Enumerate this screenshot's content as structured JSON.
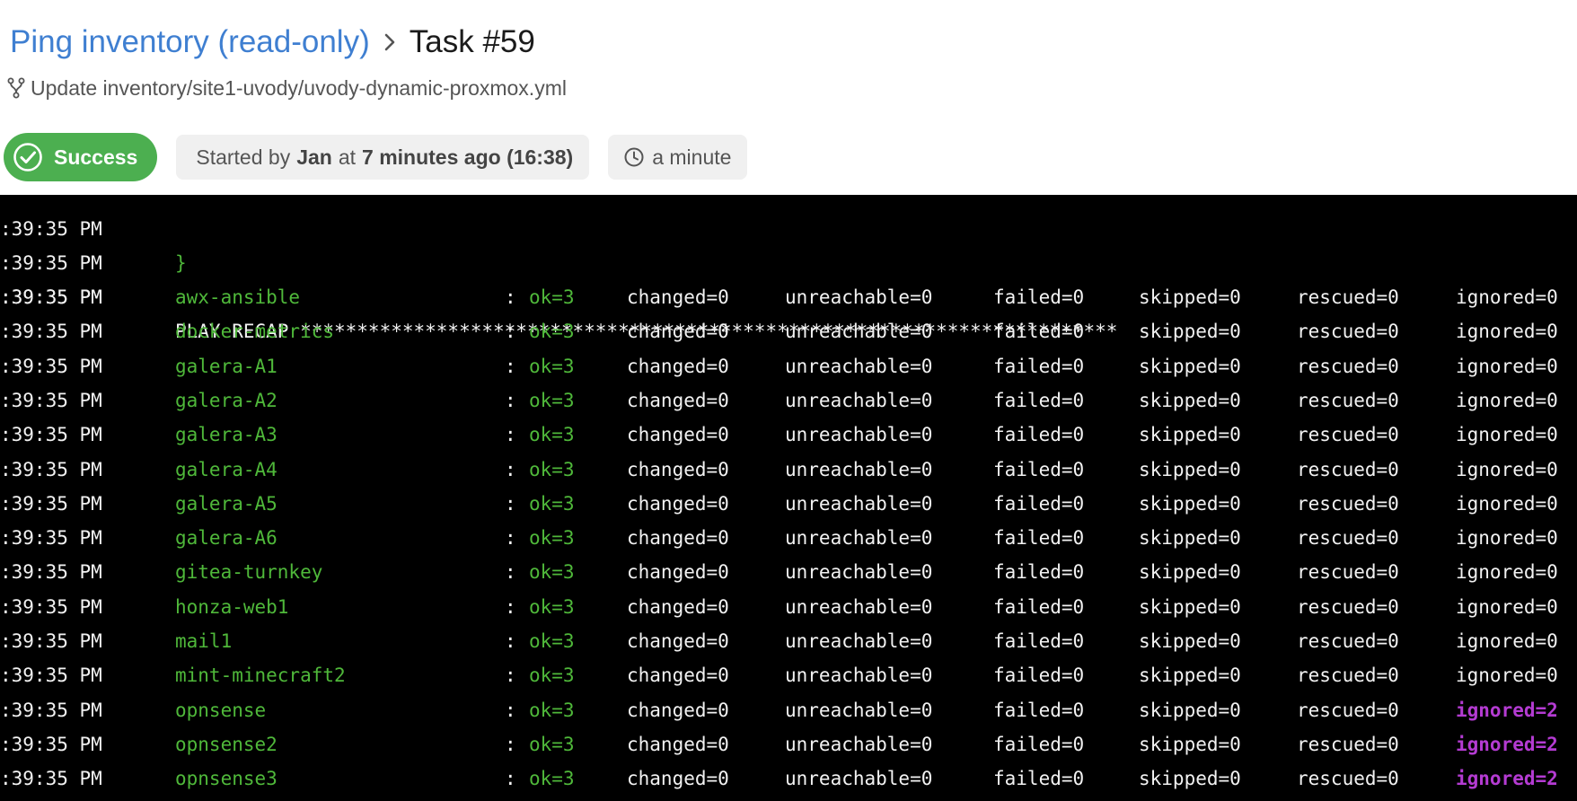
{
  "header": {
    "breadcrumb_link": "Ping inventory (read-only)",
    "task_title": "Task #59",
    "commit_message": "Update inventory/site1-uvody/uvody-dynamic-proxmox.yml",
    "status_label": "Success",
    "started_prefix": "Started by",
    "started_user": "Jan",
    "started_middle": "at",
    "started_time": "7 minutes ago (16:38)",
    "duration": "a minute"
  },
  "colors": {
    "link": "#3f7fd1",
    "success": "#4caf50",
    "host_ok": "#4fb83a",
    "ignored_warning": "#b43bd2",
    "terminal_bg": "#000000"
  },
  "icons": {
    "breadcrumb_separator": "chevron-right-icon",
    "commit": "git-branch-icon",
    "status": "check-circle-icon",
    "duration": "clock-icon"
  },
  "log": {
    "partial_line": {
      "time": ":39:35 PM",
      "text": "}"
    },
    "blank_line": {
      "time": ":39:35 PM"
    },
    "recap_line": {
      "time": ":39:35 PM",
      "text": "PLAY RECAP ************************************************************************"
    },
    "hosts": [
      {
        "time": ":39:35 PM",
        "host": "awx-ansible",
        "sep": ":",
        "ok": "ok=3",
        "changed": "changed=0",
        "unreachable": "unreachable=0",
        "failed": "failed=0",
        "skipped": "skipped=0",
        "rescued": "rescued=0",
        "ignored": "ignored=0",
        "ignored_nonzero": false
      },
      {
        "time": ":39:35 PM",
        "host": "docker-metrics",
        "sep": ":",
        "ok": "ok=3",
        "changed": "changed=0",
        "unreachable": "unreachable=0",
        "failed": "failed=0",
        "skipped": "skipped=0",
        "rescued": "rescued=0",
        "ignored": "ignored=0",
        "ignored_nonzero": false
      },
      {
        "time": ":39:35 PM",
        "host": "galera-A1",
        "sep": ":",
        "ok": "ok=3",
        "changed": "changed=0",
        "unreachable": "unreachable=0",
        "failed": "failed=0",
        "skipped": "skipped=0",
        "rescued": "rescued=0",
        "ignored": "ignored=0",
        "ignored_nonzero": false
      },
      {
        "time": ":39:35 PM",
        "host": "galera-A2",
        "sep": ":",
        "ok": "ok=3",
        "changed": "changed=0",
        "unreachable": "unreachable=0",
        "failed": "failed=0",
        "skipped": "skipped=0",
        "rescued": "rescued=0",
        "ignored": "ignored=0",
        "ignored_nonzero": false
      },
      {
        "time": ":39:35 PM",
        "host": "galera-A3",
        "sep": ":",
        "ok": "ok=3",
        "changed": "changed=0",
        "unreachable": "unreachable=0",
        "failed": "failed=0",
        "skipped": "skipped=0",
        "rescued": "rescued=0",
        "ignored": "ignored=0",
        "ignored_nonzero": false
      },
      {
        "time": ":39:35 PM",
        "host": "galera-A4",
        "sep": ":",
        "ok": "ok=3",
        "changed": "changed=0",
        "unreachable": "unreachable=0",
        "failed": "failed=0",
        "skipped": "skipped=0",
        "rescued": "rescued=0",
        "ignored": "ignored=0",
        "ignored_nonzero": false
      },
      {
        "time": ":39:35 PM",
        "host": "galera-A5",
        "sep": ":",
        "ok": "ok=3",
        "changed": "changed=0",
        "unreachable": "unreachable=0",
        "failed": "failed=0",
        "skipped": "skipped=0",
        "rescued": "rescued=0",
        "ignored": "ignored=0",
        "ignored_nonzero": false
      },
      {
        "time": ":39:35 PM",
        "host": "galera-A6",
        "sep": ":",
        "ok": "ok=3",
        "changed": "changed=0",
        "unreachable": "unreachable=0",
        "failed": "failed=0",
        "skipped": "skipped=0",
        "rescued": "rescued=0",
        "ignored": "ignored=0",
        "ignored_nonzero": false
      },
      {
        "time": ":39:35 PM",
        "host": "gitea-turnkey",
        "sep": ":",
        "ok": "ok=3",
        "changed": "changed=0",
        "unreachable": "unreachable=0",
        "failed": "failed=0",
        "skipped": "skipped=0",
        "rescued": "rescued=0",
        "ignored": "ignored=0",
        "ignored_nonzero": false
      },
      {
        "time": ":39:35 PM",
        "host": "honza-web1",
        "sep": ":",
        "ok": "ok=3",
        "changed": "changed=0",
        "unreachable": "unreachable=0",
        "failed": "failed=0",
        "skipped": "skipped=0",
        "rescued": "rescued=0",
        "ignored": "ignored=0",
        "ignored_nonzero": false
      },
      {
        "time": ":39:35 PM",
        "host": "mail1",
        "sep": ":",
        "ok": "ok=3",
        "changed": "changed=0",
        "unreachable": "unreachable=0",
        "failed": "failed=0",
        "skipped": "skipped=0",
        "rescued": "rescued=0",
        "ignored": "ignored=0",
        "ignored_nonzero": false
      },
      {
        "time": ":39:35 PM",
        "host": "mint-minecraft2",
        "sep": ":",
        "ok": "ok=3",
        "changed": "changed=0",
        "unreachable": "unreachable=0",
        "failed": "failed=0",
        "skipped": "skipped=0",
        "rescued": "rescued=0",
        "ignored": "ignored=0",
        "ignored_nonzero": false
      },
      {
        "time": ":39:35 PM",
        "host": "opnsense",
        "sep": ":",
        "ok": "ok=3",
        "changed": "changed=0",
        "unreachable": "unreachable=0",
        "failed": "failed=0",
        "skipped": "skipped=0",
        "rescued": "rescued=0",
        "ignored": "ignored=2",
        "ignored_nonzero": true
      },
      {
        "time": ":39:35 PM",
        "host": "opnsense2",
        "sep": ":",
        "ok": "ok=3",
        "changed": "changed=0",
        "unreachable": "unreachable=0",
        "failed": "failed=0",
        "skipped": "skipped=0",
        "rescued": "rescued=0",
        "ignored": "ignored=2",
        "ignored_nonzero": true
      },
      {
        "time": ":39:35 PM",
        "host": "opnsense3",
        "sep": ":",
        "ok": "ok=3",
        "changed": "changed=0",
        "unreachable": "unreachable=0",
        "failed": "failed=0",
        "skipped": "skipped=0",
        "rescued": "rescued=0",
        "ignored": "ignored=2",
        "ignored_nonzero": true
      }
    ]
  }
}
